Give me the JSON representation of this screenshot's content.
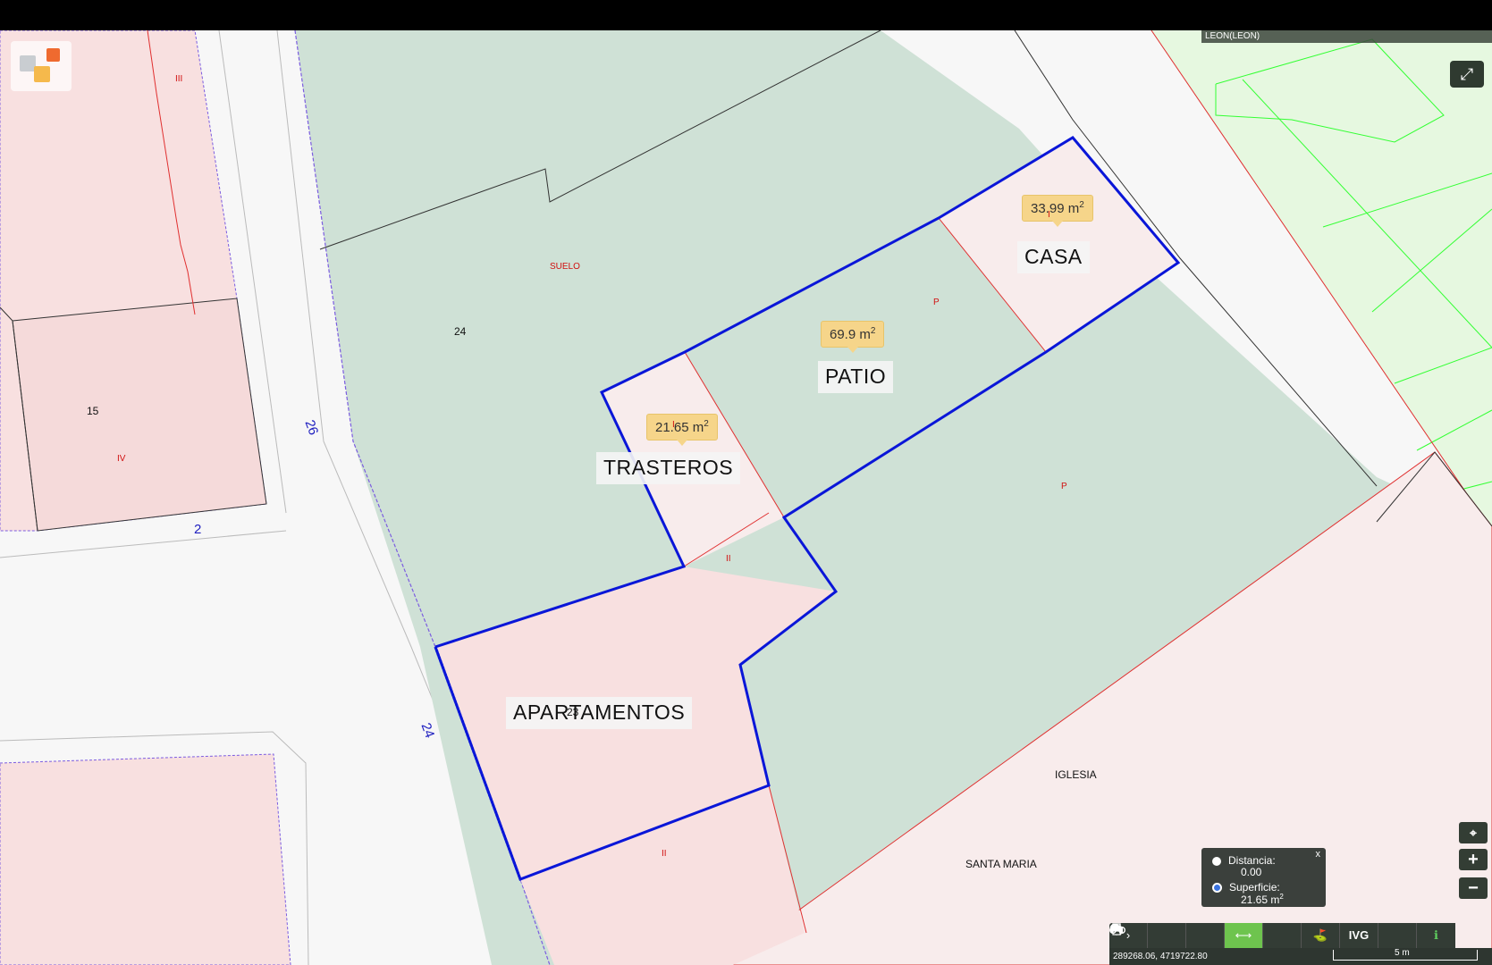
{
  "header": {
    "province": "LEON(LEON)"
  },
  "regions": {
    "casa": {
      "label": "CASA",
      "area": "33.99",
      "unit": "m",
      "unit_power": "2"
    },
    "patio": {
      "label": "PATIO",
      "area": "69.9",
      "unit": "m",
      "unit_power": "2"
    },
    "trasteros": {
      "label": "TRASTEROS",
      "area": "21.65",
      "unit": "m",
      "unit_power": "2"
    },
    "apartamentos": {
      "label": "APARTAMENTOS"
    }
  },
  "map_labels": {
    "suelo": "SUELO",
    "parcel_24": "24",
    "parcel_15": "15",
    "parcel_23": "23",
    "roman_iii": "III",
    "roman_iv": "IV",
    "roman_ii_a": "II",
    "roman_ii_b": "II",
    "p_a": "P",
    "p_b": "P",
    "i_casa": "I",
    "i_trasteros": "I",
    "street_26": "26",
    "street_2": "2",
    "street_24": "24",
    "iglesia": "IGLESIA",
    "santa_maria": "SANTA MARIA"
  },
  "measure_panel": {
    "distance_label": "Distancia:",
    "distance_value": "0.00",
    "surface_label": "Superficie:",
    "surface_value": "21.65 m",
    "surface_power": "2",
    "selected": "Superficie",
    "close": "x"
  },
  "toolbar": {
    "items": [
      "›",
      "search-icon",
      "layers-icon",
      "measure-icon",
      "print-icon",
      "parcel-icon",
      "IVG",
      "bike-icon",
      "info-icon"
    ],
    "ivg_label": "IVG",
    "active": "measure-icon"
  },
  "status": {
    "coordinates": "289268.06, 4719722.80",
    "scale": "5 m"
  },
  "colors": {
    "parcel_green": "#cfe1d6",
    "parcel_pink": "#f8dfdf",
    "selection_blue": "#0a16d8",
    "area_tag": "#f6d58a",
    "adjacent_green": "#33ff33"
  }
}
